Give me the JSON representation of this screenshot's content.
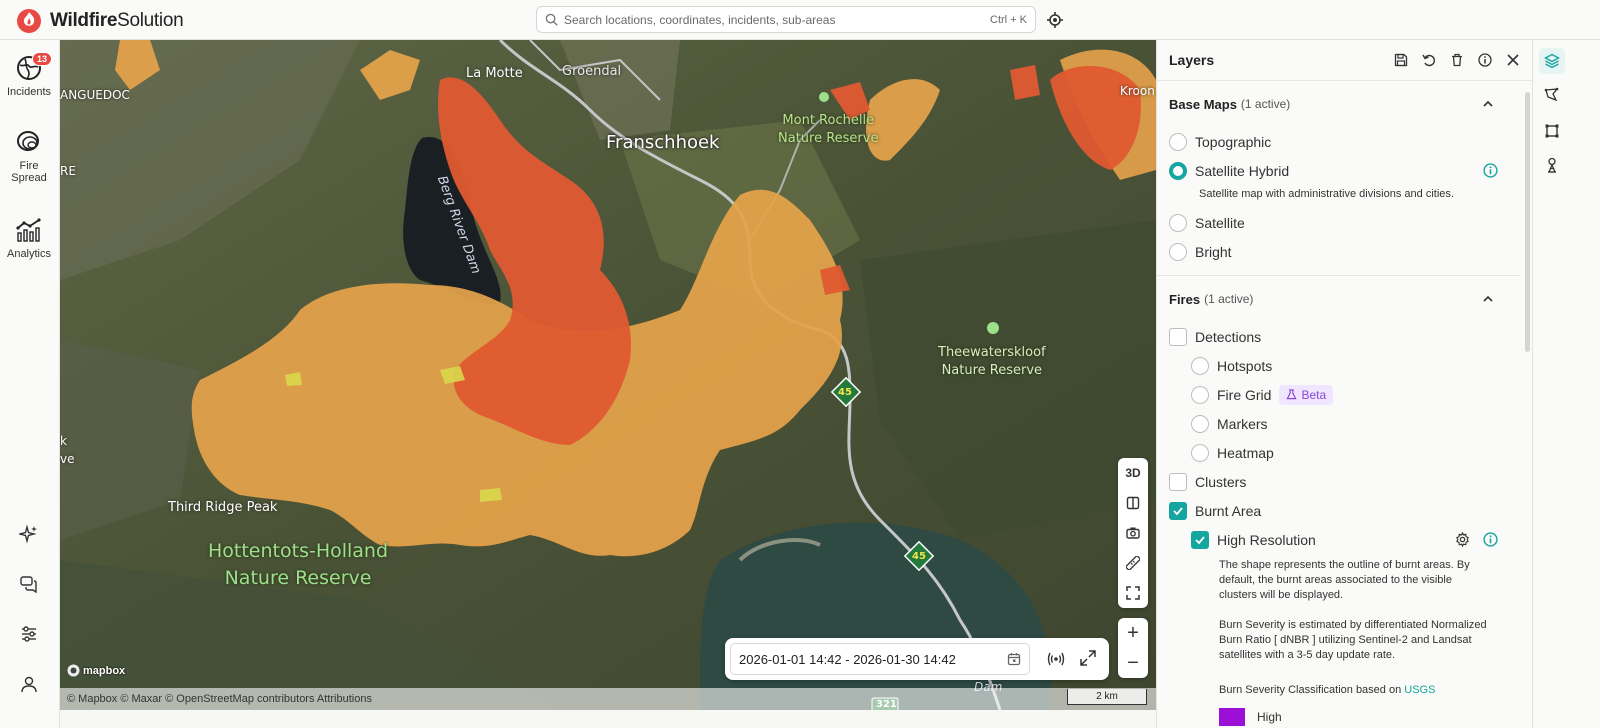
{
  "app": {
    "name_bold": "Wildfire",
    "name_light": "Solution"
  },
  "search": {
    "placeholder": "Search locations, coordinates, incidents, sub-areas",
    "shortcut": "Ctrl + K"
  },
  "nav": {
    "incidents": {
      "label": "Incidents",
      "badge": "13"
    },
    "fire_spread": {
      "label_line1": "Fire",
      "label_line2": "Spread"
    },
    "analytics": {
      "label": "Analytics"
    }
  },
  "map": {
    "labels": {
      "la_motte": "La Motte",
      "groendal": "Groendal",
      "franschhoek": "Franschhoek",
      "mont_rochelle": "Mont Rochelle\nNature Reserve",
      "berg_river_dam": "Berg River Dam",
      "theewaterskloof": "Theewaterskloof\nNature Reserve",
      "third_ridge_peak": "Third Ridge Peak",
      "hottentots": "Hottentots-Holland\nNature Reserve",
      "languedoc": "ANGUEDOC",
      "re": "RE",
      "k": "k",
      "ve": "ve",
      "kroon": "Kroon",
      "dam": "Dam",
      "route_45": "45",
      "route_321": "321"
    },
    "controls": {
      "three_d": "3D"
    },
    "date_range": "2026-01-01 14:42 - 2026-01-30 14:42",
    "mapbox": "mapbox",
    "attribution": "© Mapbox © Maxar © OpenStreetMap contributors Attributions",
    "scale": "2 km"
  },
  "layers": {
    "title": "Layers",
    "base_maps": {
      "title": "Base Maps",
      "count": "(1 active)",
      "options": [
        "Topographic",
        "Satellite Hybrid",
        "Satellite",
        "Bright"
      ],
      "selected": "Satellite Hybrid",
      "selected_desc": "Satellite map with administrative divisions and cities."
    },
    "fires": {
      "title": "Fires",
      "count": "(1 active)",
      "detections": "Detections",
      "hotspots": "Hotspots",
      "fire_grid": "Fire Grid",
      "beta": "Beta",
      "markers": "Markers",
      "heatmap": "Heatmap",
      "clusters": "Clusters",
      "burnt_area": "Burnt Area",
      "high_resolution": "High Resolution",
      "desc1": "The shape represents the outline of burnt areas. By default, the burnt areas associated to the visible clusters will be displayed.",
      "desc2": "Burn Severity is estimated by differentiated Normalized Burn Ratio [ dNBR ] utilizing Sentinel-2 and Landsat satellites with a 3-5 day update rate.",
      "classification_prefix": "Burn Severity Classification based on ",
      "classification_link": "USGS",
      "legend_high": "High",
      "legend_high_color": "#9b0fd6"
    }
  },
  "colors": {
    "accent": "#15a6a0",
    "brand": "#e84a43",
    "burn_moderate": "#e5a24a",
    "burn_high": "#e05a32"
  }
}
